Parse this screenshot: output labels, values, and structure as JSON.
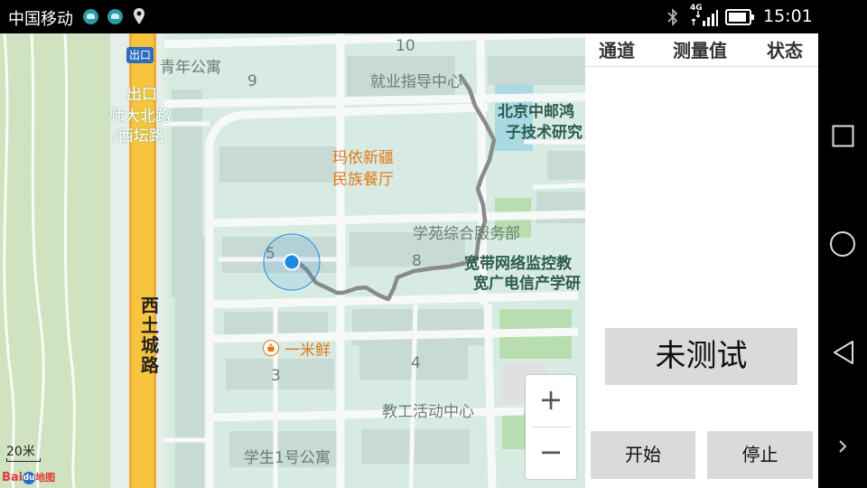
{
  "status_bar": {
    "carrier": "中国移动",
    "network": "4G",
    "time": "15:01"
  },
  "map": {
    "labels": {
      "exit_badge": "出口",
      "qingnian": "青年公寓",
      "num_10": "10",
      "num_9": "9",
      "jiuye": "就业指导中心",
      "exit_name_1": "出口",
      "exit_name_2": "师大北路",
      "exit_name_3": "/西坛路",
      "beijing_zhongyou_1": "北京中邮鸿",
      "beijing_zhongyou_2": "子技术研究",
      "mayi_1": "玛依新疆",
      "mayi_2": "民族餐厅",
      "xueyuan": "学苑综合服务部",
      "num_5": "5",
      "num_8": "8",
      "kuandai_1": "宽带网络监控教",
      "kuandai_2": "宽广电信产学研",
      "yimixian": "一米鲜",
      "num_3": "3",
      "num_4": "4",
      "jiaogong": "教工活动中心",
      "xuesheng": "学生1号公寓",
      "xitucheng": "西土城路",
      "scale": "20米",
      "logo_bai": "Bai",
      "logo_du": "du",
      "logo_ditu": "地图"
    },
    "zoom_in": "+",
    "zoom_out": "−"
  },
  "panel": {
    "headers": [
      "通道",
      "测量值",
      "状态"
    ],
    "status_button": "未测试",
    "start_button": "开始",
    "stop_button": "停止"
  },
  "colors": {
    "accent_blue": "#1e88e5",
    "track_gray": "#8a8a8a",
    "highway_yellow": "#f7c53d",
    "poi_orange": "#e07a1b"
  },
  "icons": [
    "wechat-icon",
    "wechat-icon",
    "location-pin-icon",
    "bluetooth-icon",
    "signal-icon",
    "battery-icon",
    "square-icon",
    "circle-icon",
    "back-triangle-icon",
    "chevron-right-icon"
  ]
}
